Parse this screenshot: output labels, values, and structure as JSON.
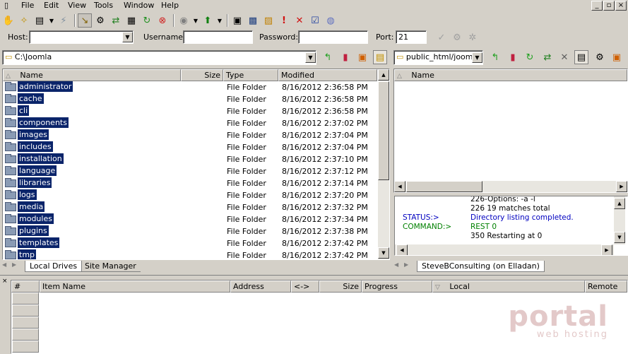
{
  "menu": [
    "File",
    "Edit",
    "View",
    "Tools",
    "Window",
    "Help"
  ],
  "connect": {
    "host_label": "Host:",
    "host_value": "",
    "username_label": "Username:",
    "username_value": "",
    "password_label": "Password:",
    "password_value": "",
    "port_label": "Port:",
    "port_value": "21"
  },
  "local": {
    "path": "C:\\Joomla",
    "columns": [
      "Name",
      "Size",
      "Type",
      "Modified"
    ],
    "files": [
      {
        "name": "administrator",
        "type": "File Folder",
        "modified": "8/16/2012 2:36:58 PM"
      },
      {
        "name": "cache",
        "type": "File Folder",
        "modified": "8/16/2012 2:36:58 PM"
      },
      {
        "name": "cli",
        "type": "File Folder",
        "modified": "8/16/2012 2:36:58 PM"
      },
      {
        "name": "components",
        "type": "File Folder",
        "modified": "8/16/2012 2:37:02 PM"
      },
      {
        "name": "images",
        "type": "File Folder",
        "modified": "8/16/2012 2:37:04 PM"
      },
      {
        "name": "includes",
        "type": "File Folder",
        "modified": "8/16/2012 2:37:04 PM"
      },
      {
        "name": "installation",
        "type": "File Folder",
        "modified": "8/16/2012 2:37:10 PM"
      },
      {
        "name": "language",
        "type": "File Folder",
        "modified": "8/16/2012 2:37:12 PM"
      },
      {
        "name": "libraries",
        "type": "File Folder",
        "modified": "8/16/2012 2:37:14 PM"
      },
      {
        "name": "logs",
        "type": "File Folder",
        "modified": "8/16/2012 2:37:20 PM"
      },
      {
        "name": "media",
        "type": "File Folder",
        "modified": "8/16/2012 2:37:32 PM"
      },
      {
        "name": "modules",
        "type": "File Folder",
        "modified": "8/16/2012 2:37:34 PM"
      },
      {
        "name": "plugins",
        "type": "File Folder",
        "modified": "8/16/2012 2:37:38 PM"
      },
      {
        "name": "templates",
        "type": "File Folder",
        "modified": "8/16/2012 2:37:42 PM"
      },
      {
        "name": "tmp",
        "type": "File Folder",
        "modified": "8/16/2012 2:37:42 PM"
      }
    ],
    "tabs": [
      "Local Drives",
      "Site Manager"
    ]
  },
  "remote": {
    "path": "public_html/joomla",
    "columns": [
      "Name"
    ],
    "tab": "SteveBConsulting (on Elladan)"
  },
  "log": [
    {
      "label": "",
      "text": "226-Options: -a -l",
      "color": "black"
    },
    {
      "label": "",
      "text": "226 19 matches total",
      "color": "black"
    },
    {
      "label": "STATUS:>",
      "text": "Directory listing completed.",
      "color": "blue"
    },
    {
      "label": "COMMAND:>",
      "text": "REST 0",
      "color": "green"
    },
    {
      "label": "",
      "text": "350 Restarting at 0",
      "color": "black"
    }
  ],
  "queue": {
    "columns": [
      "#",
      "Item Name",
      "Address",
      "<->",
      "Size",
      "Progress",
      "Local",
      "Remote"
    ]
  },
  "watermark": {
    "brand": "portal",
    "sub": "web hosting"
  }
}
